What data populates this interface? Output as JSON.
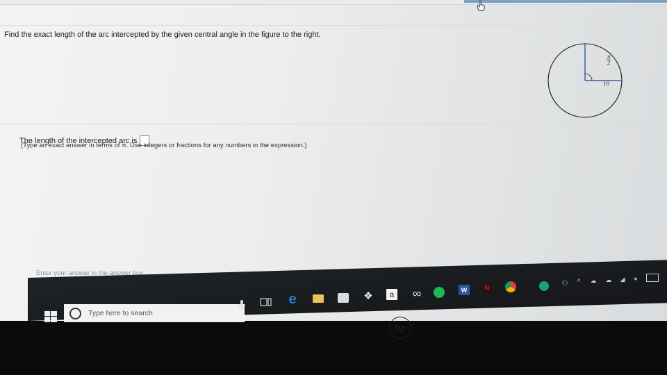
{
  "question": {
    "prompt": "Find the exact length of the arc intercepted by the given central angle in the figure to the right.",
    "answer_prefix": "The length of the intercepted arc is",
    "answer_value": "",
    "hint": "(Type an exact answer in terms of π. Use integers or fractions for any numbers in the expression.)",
    "footer_hint": "Enter your answer in the answer box."
  },
  "figure": {
    "angle_numerator": "π",
    "angle_denominator": "2",
    "radius_label": "10"
  },
  "taskbar": {
    "search_placeholder": "Type here to search",
    "amazon_label": "a",
    "word_label": "W",
    "netflix_label": "N",
    "brand_logo": "hp",
    "colors": {
      "edge": "#2b7cd3",
      "spotify": "#1db954",
      "word": "#2b579a",
      "netflix": "#e50914",
      "chrome": "#f2b400",
      "help": "#1a9e77"
    }
  }
}
